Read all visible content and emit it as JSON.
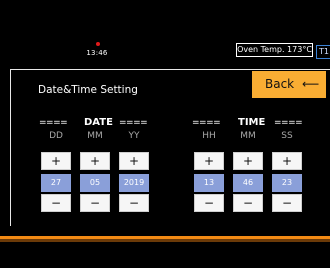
{
  "status": {
    "time": "13:46",
    "oven_temp": "Oven Temp. 173°C",
    "mode_label": "T1",
    "alarm_color": "#e01a1a"
  },
  "screen": {
    "title": "Date&Time Setting",
    "back_label": "Back",
    "back_icon": "arrow-left-icon",
    "accent_color": "#f9ad33",
    "value_color": "#8a9fd9"
  },
  "date_group": {
    "left_rule": "====",
    "label": "DATE",
    "right_rule": "====",
    "fields": [
      {
        "label": "DD",
        "value": "27",
        "plus": "+",
        "minus": "−"
      },
      {
        "label": "MM",
        "value": "05",
        "plus": "+",
        "minus": "−"
      },
      {
        "label": "YY",
        "value": "2019",
        "plus": "+",
        "minus": "−"
      }
    ]
  },
  "time_group": {
    "left_rule": "====",
    "label": "TIME",
    "right_rule": "====",
    "fields": [
      {
        "label": "HH",
        "value": "13",
        "plus": "+",
        "minus": "−"
      },
      {
        "label": "MM",
        "value": "46",
        "plus": "+",
        "minus": "−"
      },
      {
        "label": "SS",
        "value": "23",
        "plus": "+",
        "minus": "−"
      }
    ]
  }
}
